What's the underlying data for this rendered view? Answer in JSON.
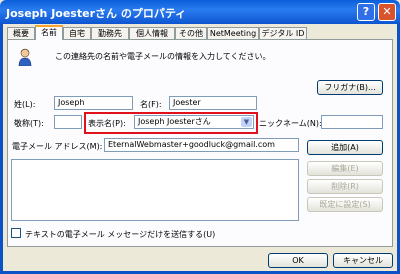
{
  "window": {
    "title": "Joseph Joesterさん のプロパティ",
    "help": "?",
    "close": "✕"
  },
  "tabs": [
    "概要",
    "名前",
    "自宅",
    "勤務先",
    "個人情報",
    "その他",
    "NetMeeting",
    "デジタル ID"
  ],
  "description": "この連絡先の名前や電子メールの情報を入力してください。",
  "buttons": {
    "furigana": "フリガナ(B)...",
    "add": "追加(A)",
    "edit": "編集(E)",
    "delete": "削除(R)",
    "set_default": "既定に設定(S)",
    "ok": "OK",
    "cancel": "キャンセル"
  },
  "fields": {
    "last_name_label": "姓(L):",
    "last_name": "Joseph",
    "first_name_label": "名(F):",
    "first_name": "Joester",
    "title_label": "敬称(T):",
    "title": "",
    "display_label": "表示名(P):",
    "display": "Joseph Joesterさん",
    "nickname_label": "ニックネーム(N):",
    "nickname": "",
    "email_label": "電子メール アドレス(M):",
    "email": "EternalWebmaster+goodluck@gmail.com"
  },
  "checkbox_label": "テキストの電子メール メッセージだけを送信する(U)",
  "icons": {
    "person": "person-icon",
    "dropdown": "chevron-down-icon"
  }
}
